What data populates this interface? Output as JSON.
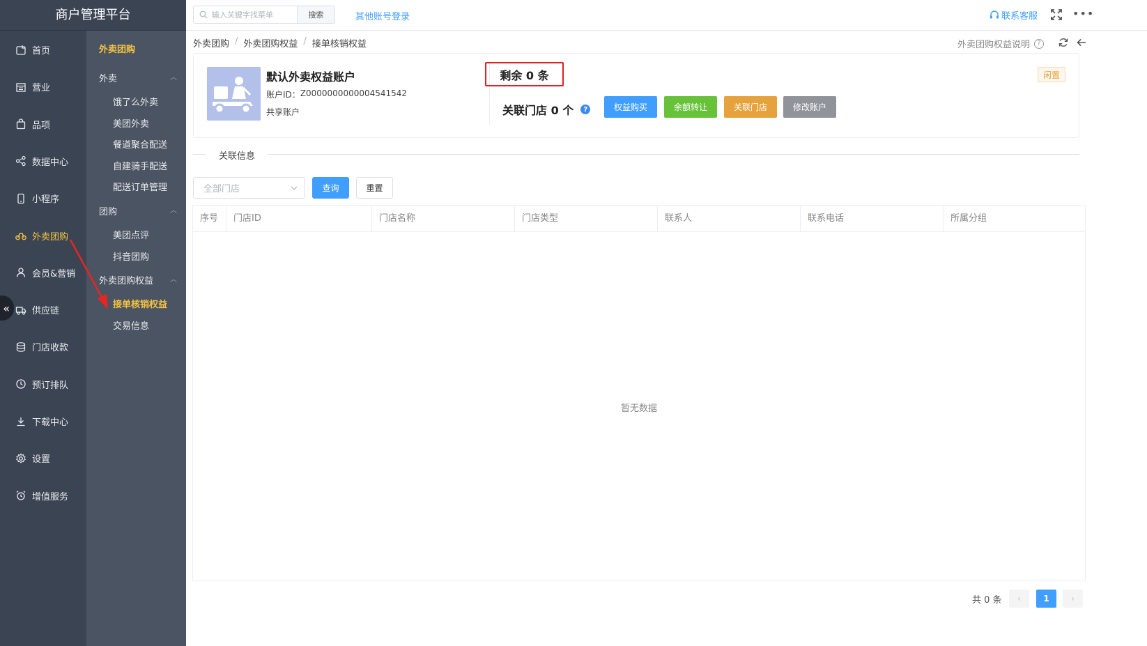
{
  "app": {
    "title": "商户管理平台"
  },
  "sidebar": {
    "items": [
      {
        "label": "首页",
        "icon": "home-icon"
      },
      {
        "label": "营业",
        "icon": "calendar-icon"
      },
      {
        "label": "品项",
        "icon": "bag-icon"
      },
      {
        "label": "数据中心",
        "icon": "share-icon"
      },
      {
        "label": "小程序",
        "icon": "phone-icon"
      },
      {
        "label": "外卖团购",
        "icon": "bike-icon",
        "active": true
      },
      {
        "label": "会员&营销",
        "icon": "user-icon"
      },
      {
        "label": "供应链",
        "icon": "truck-icon"
      },
      {
        "label": "门店收款",
        "icon": "coins-icon"
      },
      {
        "label": "预订排队",
        "icon": "clock-icon"
      },
      {
        "label": "下载中心",
        "icon": "download-icon"
      },
      {
        "label": "设置",
        "icon": "gear-icon"
      },
      {
        "label": "增值服务",
        "icon": "alarm-icon"
      }
    ],
    "collapse_label": "«"
  },
  "subnav": {
    "title": "外卖团购",
    "groups": [
      {
        "label": "外卖",
        "links": [
          "饿了么外卖",
          "美团外卖",
          "餐道聚合配送",
          "自建骑手配送",
          "配送订单管理"
        ]
      },
      {
        "label": "团购",
        "links": [
          "美团点评",
          "抖音团购"
        ]
      },
      {
        "label": "外卖团购权益",
        "links": [
          "接单核销权益",
          "交易信息"
        ]
      }
    ],
    "active_link": "接单核销权益"
  },
  "topbar": {
    "search_placeholder": "输入关键字找菜单",
    "search_button": "搜索",
    "other_login": "其他账号登录",
    "support": "联系客服"
  },
  "breadcrumb": [
    "外卖团购",
    "外卖团购权益",
    "接单核销权益"
  ],
  "help_link": "外卖团购权益说明",
  "account": {
    "name": "默认外卖权益账户",
    "id_label": "账户ID：",
    "id_value": "Z0000000000004541542",
    "type": "共享账户",
    "remaining": "剩余 0 条",
    "linked_stores": "关联门店 0 个",
    "status": "闲置",
    "actions": [
      {
        "label": "权益购买",
        "color": "#409eff"
      },
      {
        "label": "余额转让",
        "color": "#67c23a"
      },
      {
        "label": "关联门店",
        "color": "#e6a23c"
      },
      {
        "label": "修改账户",
        "color": "#909399"
      }
    ]
  },
  "section": {
    "title": "关联信息"
  },
  "filters": {
    "store_placeholder": "全部门店",
    "query": "查询",
    "reset": "重置"
  },
  "table": {
    "columns": [
      "序号",
      "门店ID",
      "门店名称",
      "门店类型",
      "联系人",
      "联系电话",
      "所属分组"
    ],
    "empty_text": "暂无数据"
  },
  "pagination": {
    "total": "共 0 条",
    "current_page": "1",
    "prev": "‹",
    "next": "›"
  }
}
